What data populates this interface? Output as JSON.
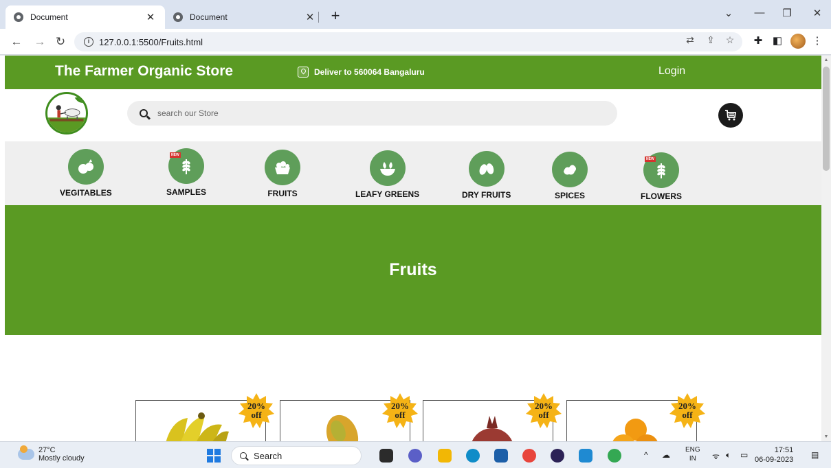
{
  "browser": {
    "tabs": [
      {
        "title": "Document",
        "active": true
      },
      {
        "title": "Document",
        "active": false
      }
    ],
    "url": "127.0.0.1:5500/Fruits.html"
  },
  "site": {
    "brand": "The Farmer Organic Store",
    "deliver": "Deliver to 560064 Bangaluru",
    "login": "Login",
    "search_placeholder": "search our Store"
  },
  "categories": [
    {
      "label": "VEGITABLES",
      "icon": "vegetables-icon",
      "new": false
    },
    {
      "label": "SAMPLES",
      "icon": "wheat-icon",
      "new": true
    },
    {
      "label": "FRUITS",
      "icon": "fruit-basket-icon",
      "new": false
    },
    {
      "label": "LEAFY GREENS",
      "icon": "leafy-bowl-icon",
      "new": false
    },
    {
      "label": "DRY FRUITS",
      "icon": "almond-icon",
      "new": false
    },
    {
      "label": "SPICES",
      "icon": "ginger-icon",
      "new": false
    },
    {
      "label": "FLOWERS",
      "icon": "wheat-icon",
      "new": true
    }
  ],
  "new_badge": "NEW",
  "banner": {
    "title": "Fruits"
  },
  "products": [
    {
      "name": "banana",
      "discount_top": "20%",
      "discount_bottom": "off"
    },
    {
      "name": "papaya",
      "discount_top": "20%",
      "discount_bottom": "off"
    },
    {
      "name": "pomegranate",
      "discount_top": "20%",
      "discount_bottom": "off"
    },
    {
      "name": "orange",
      "discount_top": "20%",
      "discount_bottom": "off"
    }
  ],
  "taskbar": {
    "temp": "27°C",
    "weather": "Mostly cloudy",
    "search": "Search",
    "lang_top": "ENG",
    "lang_bottom": "IN",
    "time": "17:51",
    "date": "06-09-2023"
  },
  "colors": {
    "brand_green": "#5a9a23",
    "category_icon": "#5f9e5a",
    "discount_burst": "#f5b316"
  }
}
